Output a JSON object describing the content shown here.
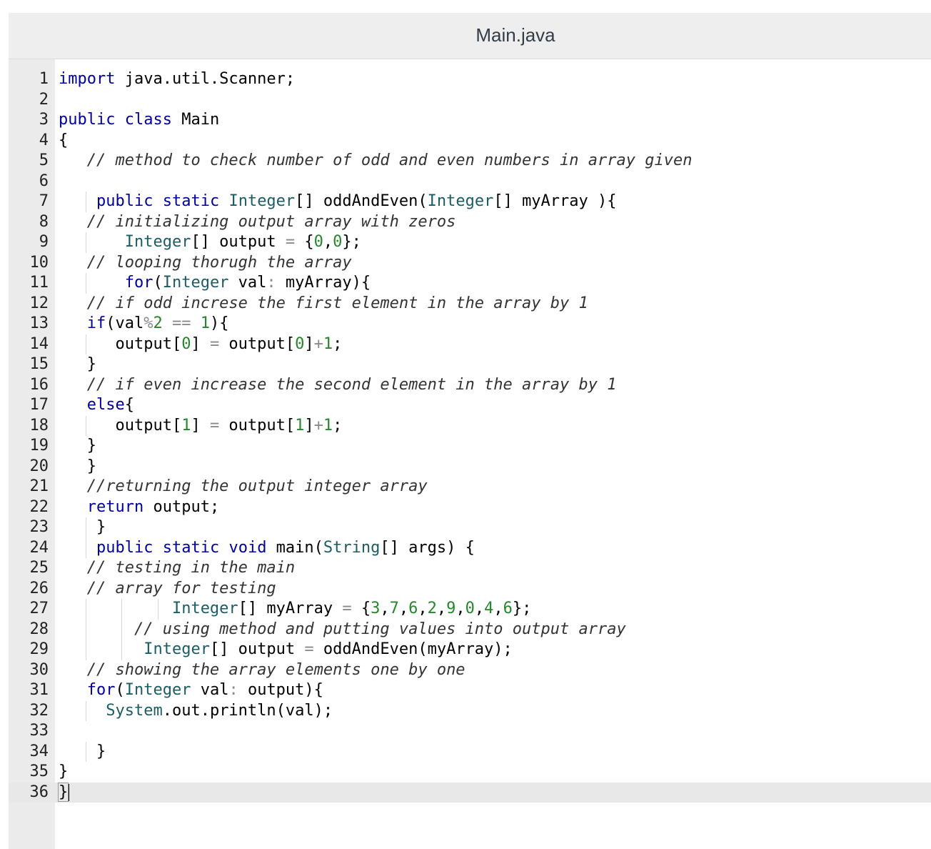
{
  "window": {
    "title": "Main.java"
  },
  "code_lines": [
    {
      "n": "1",
      "t": "import java.util.Scanner;"
    },
    {
      "n": "2",
      "t": ""
    },
    {
      "n": "3",
      "t": "public class Main"
    },
    {
      "n": "4",
      "t": "{"
    },
    {
      "n": "5",
      "t": "   // method to check number of odd and even numbers in array given"
    },
    {
      "n": "6",
      "t": ""
    },
    {
      "n": "7",
      "t": "    public static Integer[] oddAndEven(Integer[] myArray ){"
    },
    {
      "n": "8",
      "t": "   // initializing output array with zeros"
    },
    {
      "n": "9",
      "t": "       Integer[] output = {0,0};"
    },
    {
      "n": "10",
      "t": "   // looping thorugh the array"
    },
    {
      "n": "11",
      "t": "       for(Integer val: myArray){"
    },
    {
      "n": "12",
      "t": "   // if odd increse the first element in the array by 1"
    },
    {
      "n": "13",
      "t": "   if(val%2 == 1){"
    },
    {
      "n": "14",
      "t": "      output[0] = output[0]+1;"
    },
    {
      "n": "15",
      "t": "   }"
    },
    {
      "n": "16",
      "t": "   // if even increase the second element in the array by 1"
    },
    {
      "n": "17",
      "t": "   else{"
    },
    {
      "n": "18",
      "t": "      output[1] = output[1]+1;"
    },
    {
      "n": "19",
      "t": "   }"
    },
    {
      "n": "20",
      "t": "   }"
    },
    {
      "n": "21",
      "t": "   //returning the output integer array"
    },
    {
      "n": "22",
      "t": "   return output;"
    },
    {
      "n": "23",
      "t": "    }"
    },
    {
      "n": "24",
      "t": "    public static void main(String[] args) {"
    },
    {
      "n": "25",
      "t": "   // testing in the main"
    },
    {
      "n": "26",
      "t": "   // array for testing"
    },
    {
      "n": "27",
      "t": "            Integer[] myArray = {3,7,6,2,9,0,4,6};"
    },
    {
      "n": "28",
      "t": "        // using method and putting values into output array"
    },
    {
      "n": "29",
      "t": "         Integer[] output = oddAndEven(myArray);"
    },
    {
      "n": "30",
      "t": "   // showing the array elements one by one"
    },
    {
      "n": "31",
      "t": "   for(Integer val: output){"
    },
    {
      "n": "32",
      "t": "     System.out.println(val);"
    },
    {
      "n": "33",
      "t": ""
    },
    {
      "n": "34",
      "t": "    }"
    },
    {
      "n": "35",
      "t": "}"
    },
    {
      "n": "36",
      "t": "}"
    }
  ],
  "editor": {
    "active_line": 36,
    "language": "java"
  },
  "colors": {
    "keyword": "#0000a0",
    "type": "#1a5d63",
    "number": "#24872a",
    "operator": "#8a8a8a",
    "comment": "#333333",
    "gutter": "#ebebeb",
    "titlebar": "#eeeeee",
    "active_line": "#e8e8e8"
  }
}
